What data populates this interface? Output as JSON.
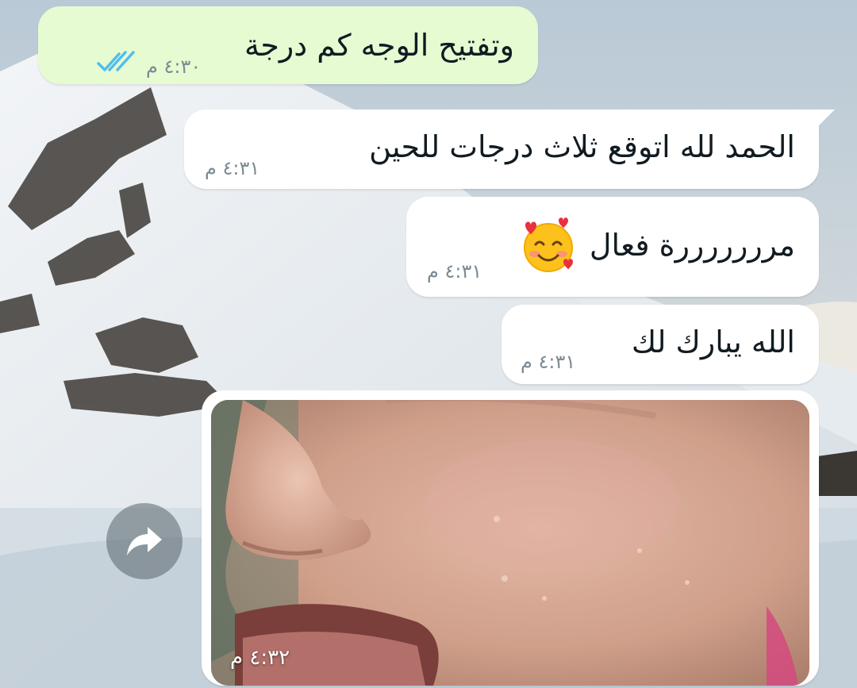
{
  "chat": {
    "messages": [
      {
        "type": "out",
        "text": "وتفتيح الوجه كم درجة",
        "time": "٤:٣٠ م",
        "status_icon": "double-check-read-icon",
        "status_color": "#53bdeb"
      },
      {
        "type": "in",
        "text": "الحمد لله اتوقع ثلاث درجات للحين",
        "time": "٤:٣١ م"
      },
      {
        "type": "in",
        "text": "مرررررررة فعال",
        "emoji": "smiling-face-with-hearts-icon",
        "time": "٤:٣١ م"
      },
      {
        "type": "in",
        "text": "الله يبارك لك",
        "time": "٤:٣١ م"
      },
      {
        "type": "in_image",
        "time": "٤:٣٢ م",
        "image": "face-skin-closeup-photo"
      }
    ],
    "forward_icon": "forward-arrow-icon"
  },
  "colors": {
    "outgoing_bubble": "#e6fbd2",
    "incoming_bubble": "#ffffff",
    "timestamp": "#7c8a92",
    "read_ticks": "#53bdeb"
  }
}
